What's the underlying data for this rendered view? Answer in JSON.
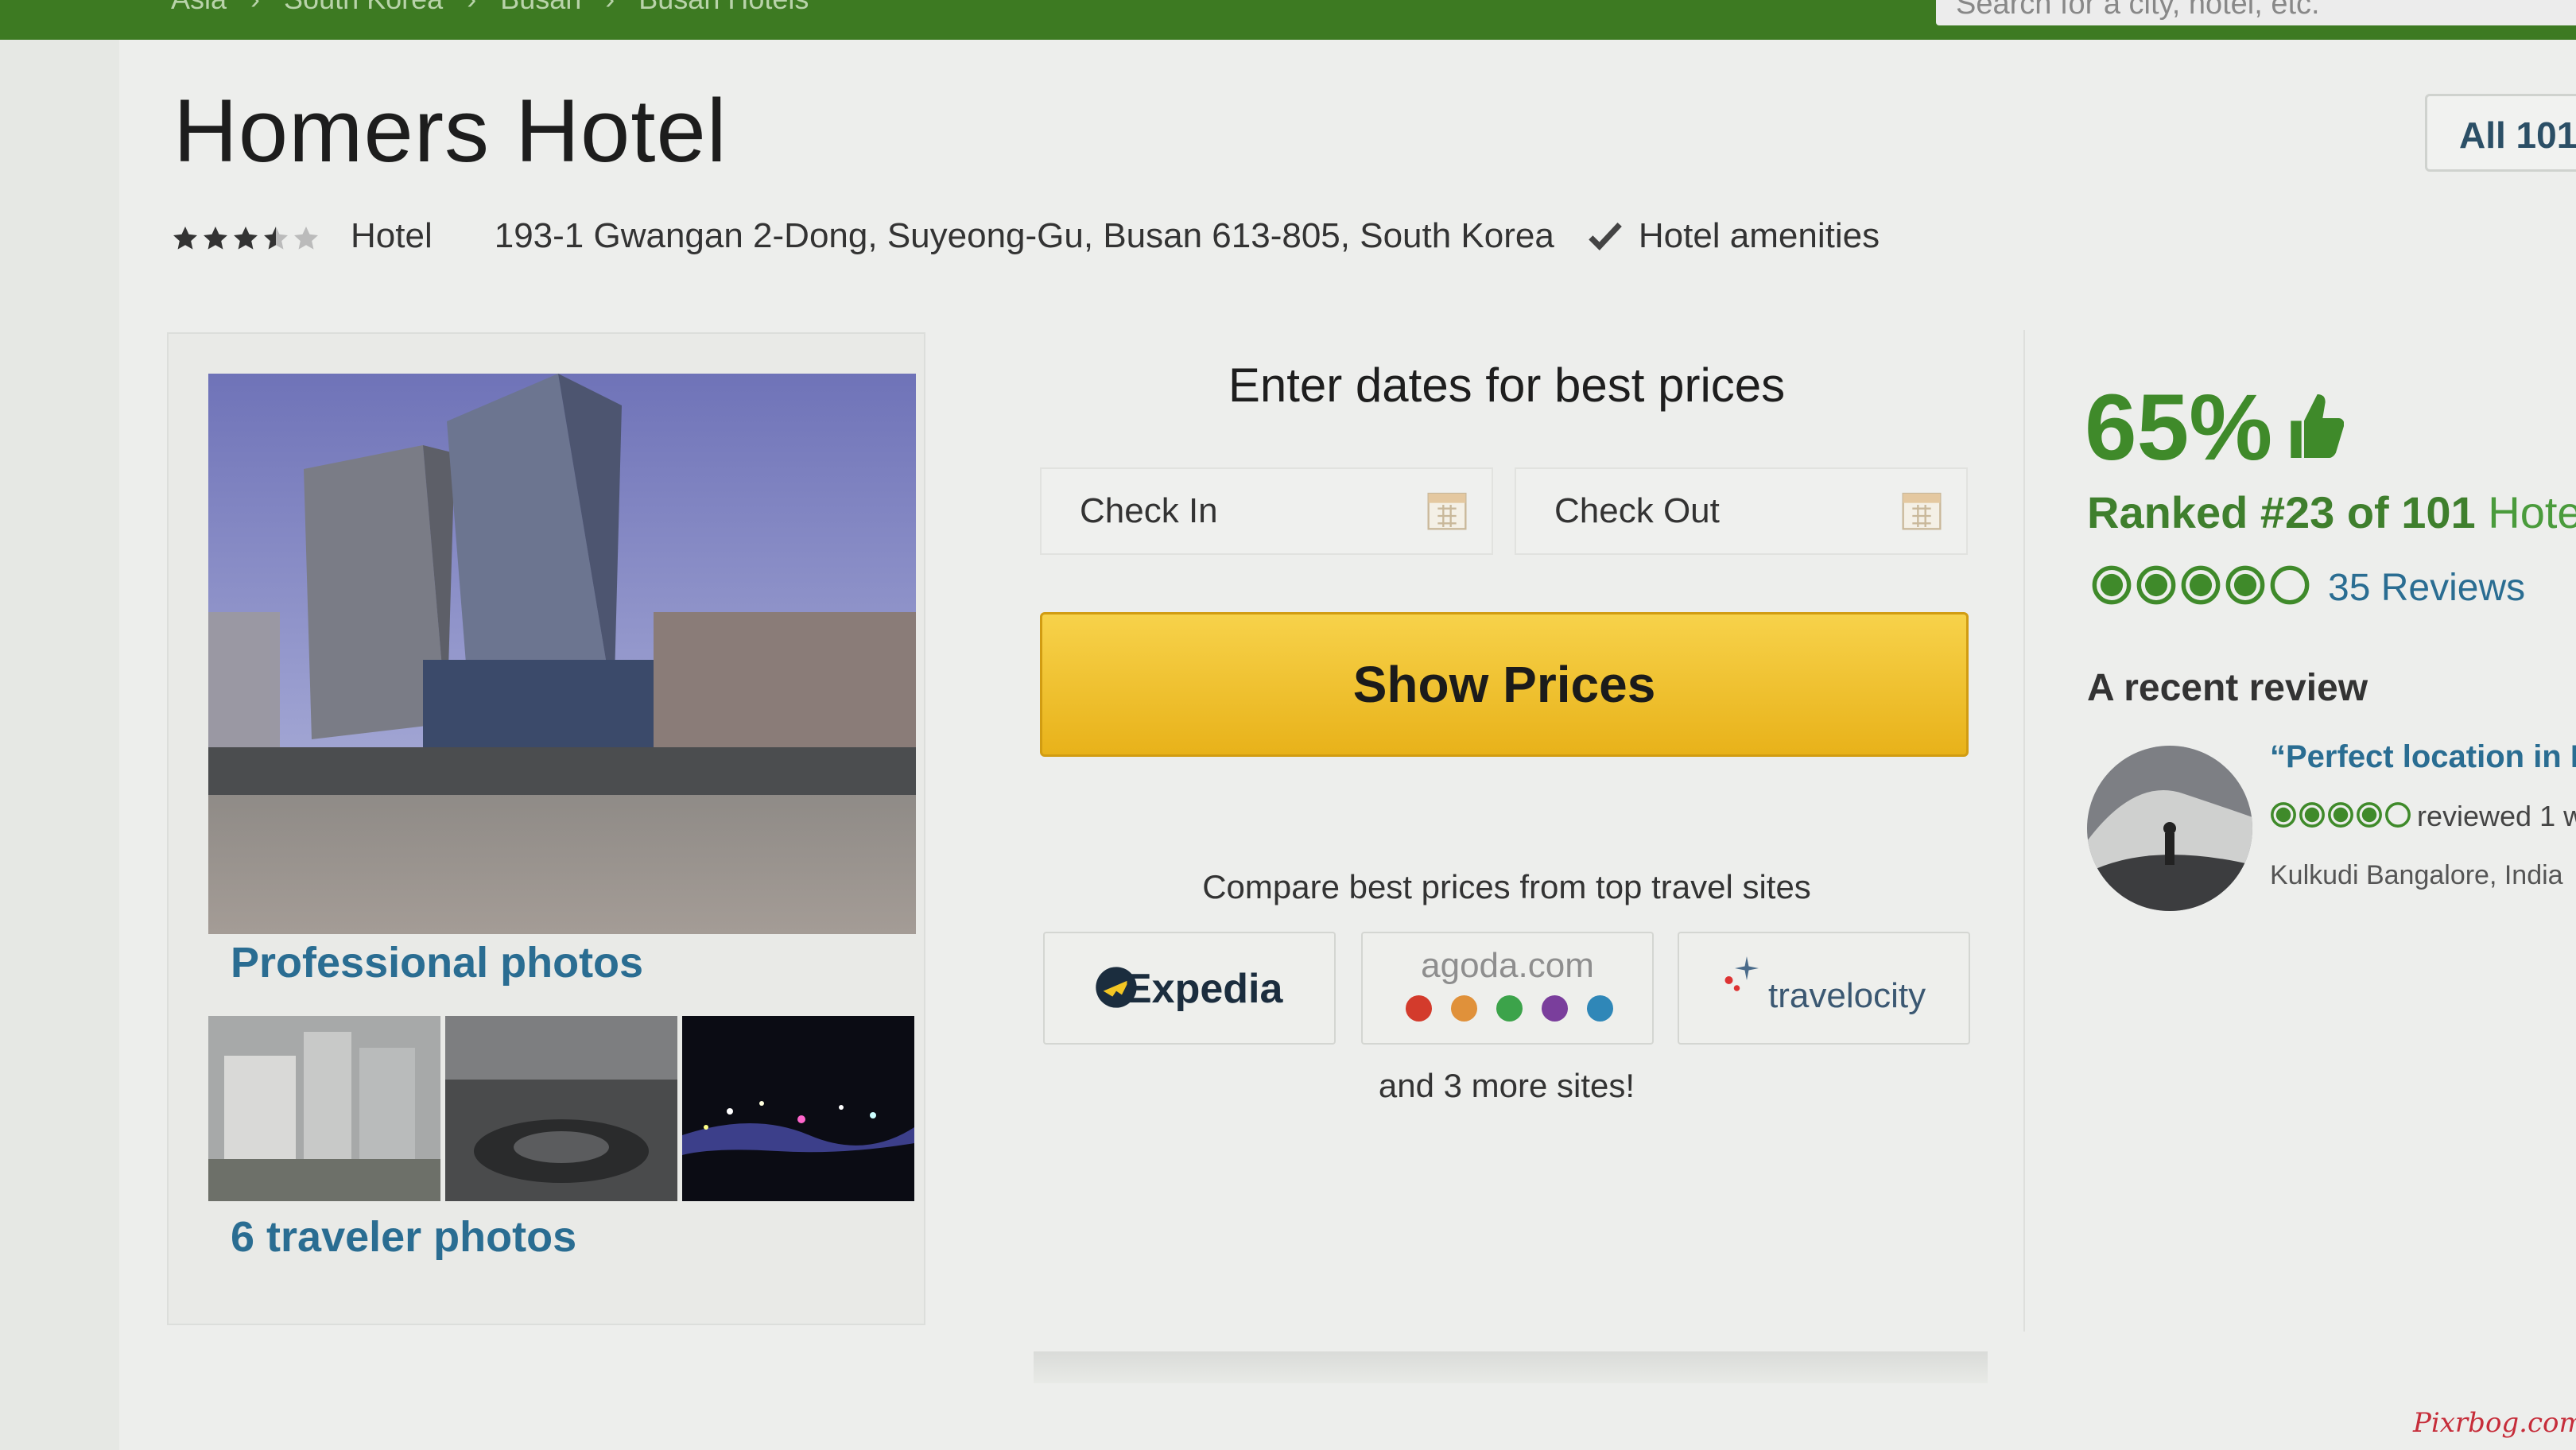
{
  "topbar": {
    "breadcrumbs": [
      "Asia",
      "South Korea",
      "Busan",
      "Busan Hotels"
    ],
    "search_placeholder": "Search for a city, hotel, etc."
  },
  "hotel": {
    "name": "Homers Hotel",
    "star_rating": 3.5,
    "type": "Hotel",
    "address": "193-1 Gwangan 2-Dong, Suyeong-Gu, Busan 613-805, South Korea",
    "amenities_label": "Hotel amenities",
    "all_button": "All 101"
  },
  "photos": {
    "professional_label": "Professional photos",
    "traveler_label": "6 traveler photos"
  },
  "booking": {
    "title": "Enter dates for best prices",
    "check_in_label": "Check In",
    "check_out_label": "Check Out",
    "show_prices_label": "Show Prices",
    "compare_text": "Compare best prices from top travel sites",
    "partners": [
      "Expedia",
      "agoda.com",
      "travelocity"
    ],
    "more_sites": "and 3 more sites!"
  },
  "summary": {
    "recommend_pct": "65%",
    "ranked_text": "Ranked #23 of 101",
    "ranked_tail": "Hotels",
    "bubble_rating": 4,
    "reviews_count_label": "35 Reviews"
  },
  "recent_review": {
    "heading": "A recent review",
    "quote": "“Perfect location in B",
    "rating": 4,
    "reviewed_text": "reviewed 1 w",
    "reviewer": "Kulkudi Bangalore, India"
  },
  "watermark": "Pixrbog.com",
  "colors": {
    "brand_green": "#3d7a22",
    "link_blue": "#2a6d92",
    "button_yellow": "#f0c232"
  }
}
